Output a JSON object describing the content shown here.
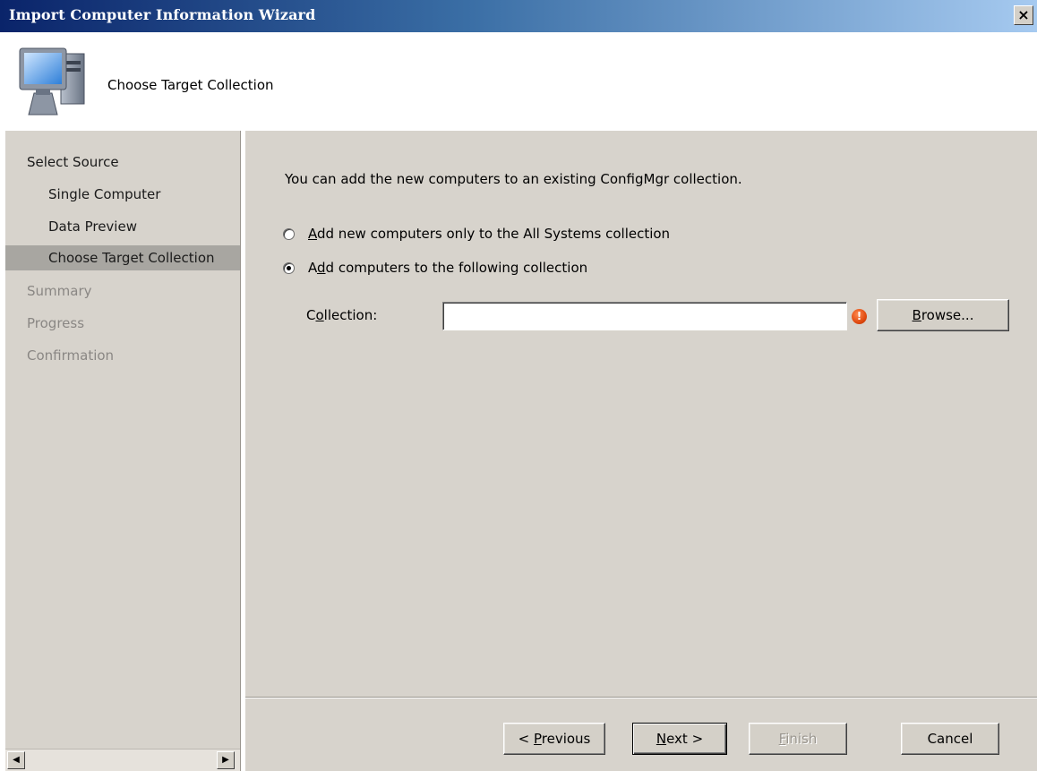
{
  "window": {
    "title": "Import Computer Information Wizard",
    "close_glyph": "×"
  },
  "header": {
    "title": "Choose Target Collection",
    "icon": "computer-icon"
  },
  "sidebar": {
    "items": [
      {
        "label": "Select Source",
        "level": 1,
        "state": "normal"
      },
      {
        "label": "Single Computer",
        "level": 2,
        "state": "normal"
      },
      {
        "label": "Data Preview",
        "level": 2,
        "state": "normal"
      },
      {
        "label": "Choose Target Collection",
        "level": 2,
        "state": "active"
      },
      {
        "label": "Summary",
        "level": 1,
        "state": "disabled"
      },
      {
        "label": "Progress",
        "level": 1,
        "state": "disabled"
      },
      {
        "label": "Confirmation",
        "level": 1,
        "state": "disabled"
      }
    ]
  },
  "main": {
    "intro": "You can add the new computers to an existing ConfigMgr collection.",
    "option1": {
      "key": "A",
      "rest": "dd new computers only to the All Systems collection",
      "selected": false
    },
    "option2": {
      "pre": "A",
      "key": "d",
      "rest": "d computers to the following collection",
      "selected": true
    },
    "collection": {
      "label_pre": "C",
      "label_key": "o",
      "label_rest": "llection:",
      "value": "",
      "error_glyph": "!"
    },
    "browse": {
      "key": "B",
      "rest": "rowse..."
    }
  },
  "footer": {
    "previous": {
      "pre": "< ",
      "key": "P",
      "rest": "revious"
    },
    "next": {
      "key": "N",
      "rest": "ext >"
    },
    "finish": {
      "key": "F",
      "rest": "inish"
    },
    "cancel": "Cancel"
  },
  "scrollbar": {
    "left_glyph": "◀",
    "right_glyph": "▶"
  }
}
